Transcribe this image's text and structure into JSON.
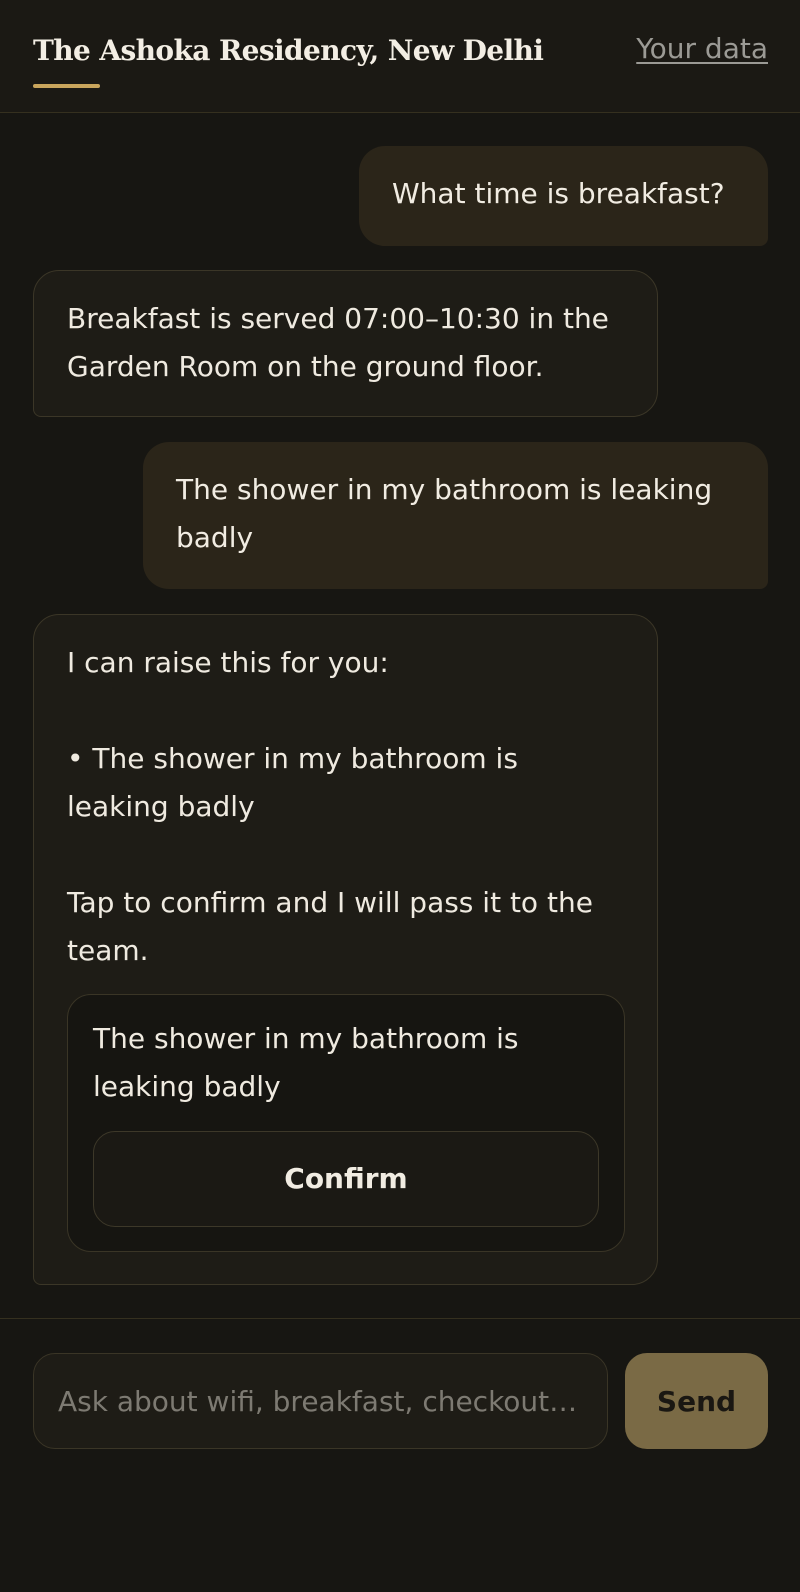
{
  "header": {
    "title": "The Ashoka Residency, New Delhi",
    "data_link": "Your data"
  },
  "messages": [
    {
      "role": "user",
      "text": "What time is breakfast?"
    },
    {
      "role": "assistant",
      "text": "Breakfast is served 07:00–10:30 in the Garden Room on the ground floor."
    },
    {
      "role": "user",
      "text": "The shower in my bathroom is leaking badly"
    },
    {
      "role": "assistant",
      "text": "I can raise this for you:\n\n• The shower in my bathroom is leaking badly\n\nTap to confirm and I will pass it to the team.",
      "ticket": {
        "text": "The shower in my bathroom is leaking badly",
        "confirm_label": "Confirm"
      }
    }
  ],
  "composer": {
    "placeholder": "Ask about wifi, breakfast, checkout…",
    "value": "",
    "send_label": "Send"
  },
  "colors": {
    "background": "#171612",
    "accent": "#c9a55c",
    "user_bubble": "#2b2519",
    "send_button": "#7a6a45"
  }
}
